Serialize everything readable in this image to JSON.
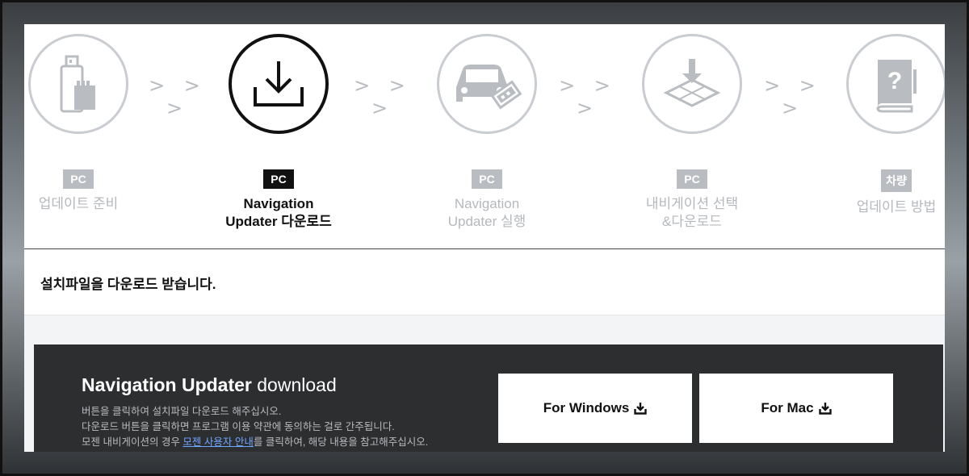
{
  "steps": [
    {
      "badge": "PC",
      "label_line1": "업데이트 준비",
      "label_line2": "",
      "icon": "usb-sdcard-icon",
      "active": false
    },
    {
      "badge": "PC",
      "label_line1": "Navigation",
      "label_line2": "Updater 다운로드",
      "icon": "download-icon",
      "active": true
    },
    {
      "badge": "PC",
      "label_line1": "Navigation",
      "label_line2": "Updater 실행",
      "icon": "car-usb-icon",
      "active": false
    },
    {
      "badge": "PC",
      "label_line1": "내비게이션 선택",
      "label_line2": "&다운로드",
      "icon": "map-download-icon",
      "active": false
    },
    {
      "badge": "차량",
      "label_line1": "업데이트 방법",
      "label_line2": "",
      "icon": "manual-book-icon",
      "active": false
    }
  ],
  "arrow_text": "> > >",
  "instruction": "설치파일을 다운로드 받습니다.",
  "download": {
    "title_bold": "Navigation Updater",
    "title_light": "download",
    "desc_line1": "버튼을 클릭하여 설치파일 다운로드 해주십시오.",
    "desc_line2": "다운로드 버튼을 클릭하면 프로그램 이용 약관에 동의하는 걸로 간주됩니다.",
    "desc_line3_pre": "모젠 내비게이션의 경우 ",
    "desc_line3_link": "모젠 사용자 안내",
    "desc_line3_post": "를 클릭하여, 해당 내용을 참고해주십시오.",
    "windows_label": "For Windows",
    "mac_label": "For Mac"
  }
}
